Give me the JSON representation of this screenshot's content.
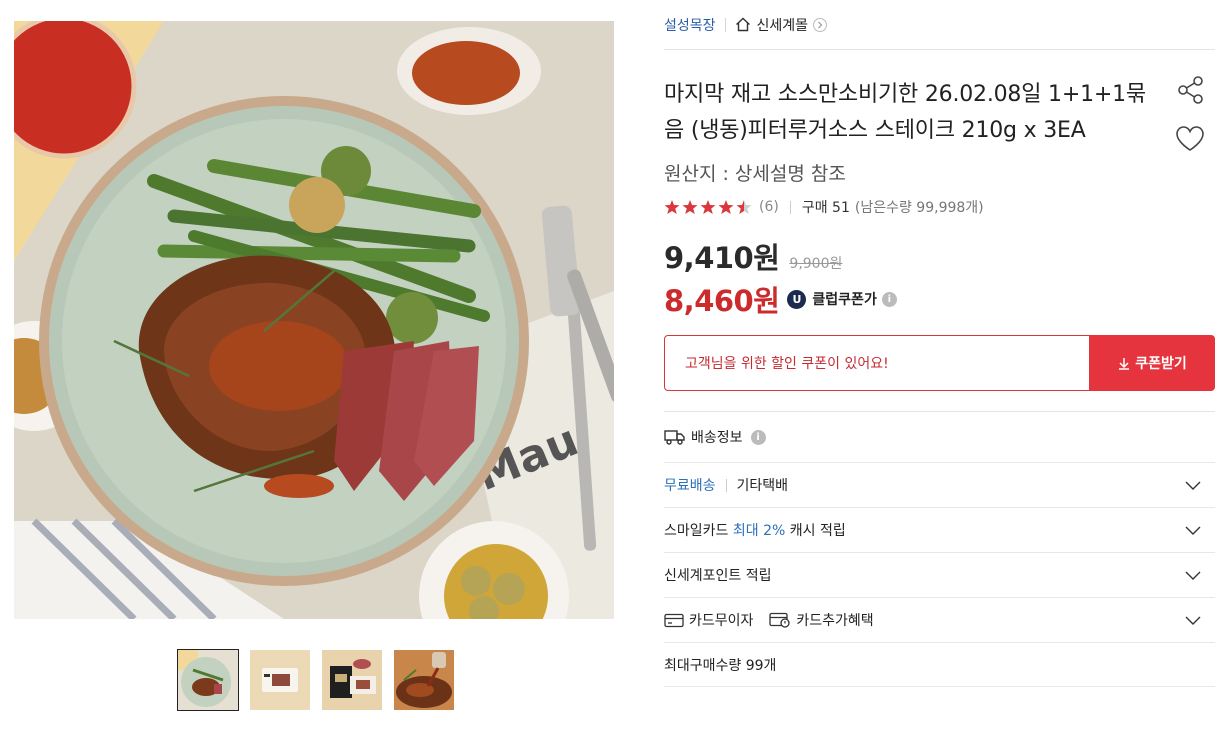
{
  "gallery": {
    "main_image": "steak-dinner-photo",
    "thumbnails": [
      {
        "name": "steak-plate",
        "active": true
      },
      {
        "name": "package-front",
        "active": false
      },
      {
        "name": "package-set",
        "active": false
      },
      {
        "name": "sauce-pour",
        "active": false
      }
    ]
  },
  "breadcrumb": {
    "brand": "설성목장",
    "store": "신세계몰"
  },
  "product": {
    "title": "마지막 재고 소스만소비기한 26.02.08일 1+1+1묶음 (냉동)피터루거소스 스테이크 210g x 3EA",
    "origin": "원산지 : 상세설명 참조",
    "rating": 4.5,
    "review_count": "(6)",
    "purchase": "구매 51",
    "remaining": "(남은수량 99,998개)"
  },
  "pricing": {
    "price": "9,410원",
    "original_price": "9,900원",
    "coupon_price": "8,460원",
    "coupon_badge": "U",
    "coupon_label": "클럽쿠폰가"
  },
  "coupon": {
    "message": "고객님을 위한 할인 쿠폰이 있어요!",
    "button": "쿠폰받기"
  },
  "shipping": {
    "title": "배송정보",
    "free_label": "무료배송",
    "courier": "기타택배"
  },
  "benefits": {
    "smilecard_prefix": "스마일카드",
    "smilecard_highlight": "최대 2%",
    "smilecard_suffix": "캐시 적립",
    "points": "신세계포인트 적립",
    "card_interest": "카드무이자",
    "card_extra": "카드추가혜택",
    "max_purchase": "최대구매수량 99개"
  },
  "colors": {
    "brand_link": "#2a5ea8",
    "sale_price": "#cc2b2b",
    "coupon_red": "#e5343d",
    "star": "#d9373d"
  },
  "icons": [
    "home-icon",
    "chevron-right-icon",
    "share-icon",
    "heart-icon",
    "star-icon",
    "info-icon",
    "download-icon",
    "truck-icon",
    "chevron-down-icon",
    "card-icon",
    "card-benefit-icon"
  ]
}
